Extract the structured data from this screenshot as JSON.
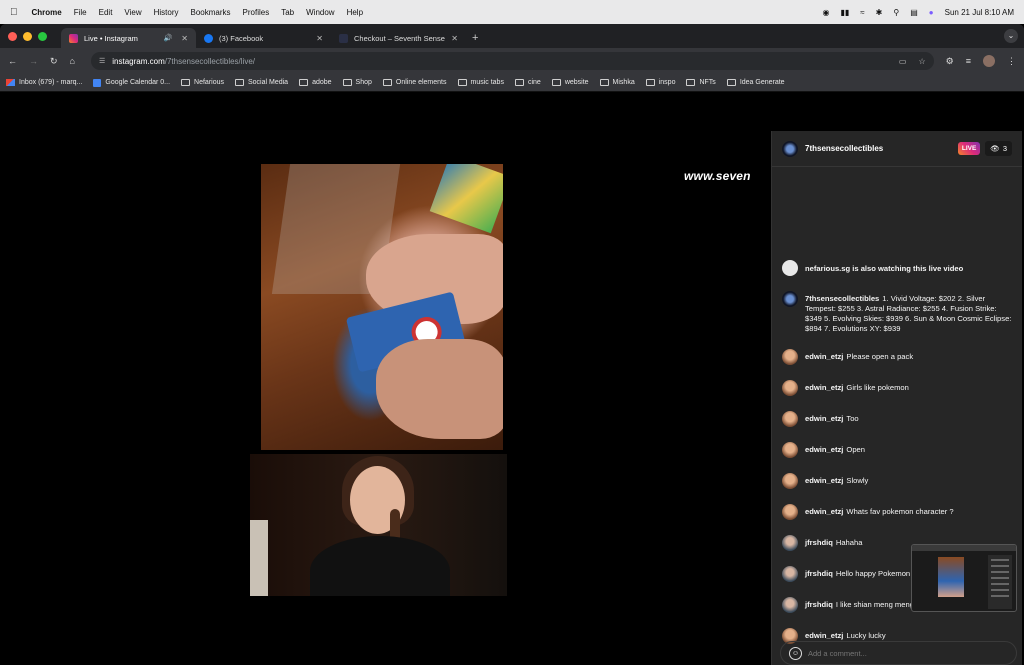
{
  "menubar": {
    "app": "Chrome",
    "items": [
      "File",
      "Edit",
      "View",
      "History",
      "Bookmarks",
      "Profiles",
      "Tab",
      "Window",
      "Help"
    ],
    "clock": "Sun 21 Jul  8:10 AM"
  },
  "tabs": [
    {
      "title": "Live • Instagram",
      "active": true,
      "color": "#dd2a7b"
    },
    {
      "title": "(3) Facebook",
      "active": false,
      "color": "#1877f2"
    },
    {
      "title": "Checkout – Seventh Sense C",
      "active": false,
      "color": "#555"
    }
  ],
  "address": {
    "host": "instagram.com",
    "path": "/7thsensecollectibles/live/"
  },
  "bookmarks": [
    {
      "label": "Inbox (679) - marq...",
      "kind": "gmail"
    },
    {
      "label": "Google Calendar 0...",
      "kind": "gcal"
    },
    {
      "label": "Nefarious",
      "kind": "folder"
    },
    {
      "label": "Social Media",
      "kind": "folder"
    },
    {
      "label": "adobe",
      "kind": "folder"
    },
    {
      "label": "Shop",
      "kind": "folder"
    },
    {
      "label": "Online elements",
      "kind": "folder"
    },
    {
      "label": "music tabs",
      "kind": "folder"
    },
    {
      "label": "cine",
      "kind": "folder"
    },
    {
      "label": "website",
      "kind": "folder"
    },
    {
      "label": "Mishka",
      "kind": "folder"
    },
    {
      "label": "inspo",
      "kind": "folder"
    },
    {
      "label": "NFTs",
      "kind": "folder"
    },
    {
      "label": "Idea Generate",
      "kind": "folder"
    }
  ],
  "stream": {
    "watermark": "www.seven"
  },
  "chat": {
    "host": "7thsensecollectibles",
    "live_label": "LIVE",
    "viewer_count": "3",
    "comment_placeholder": "Add a comment...",
    "messages": [
      {
        "user": "",
        "text": "nefarious.sg is also watching this live video",
        "avatar": "tv",
        "system": true
      },
      {
        "user": "7thsensecollectibles",
        "text": "1. Vivid Voltage: $202 2. Silver Tempest: $255 3. Astral Radiance: $255 4. Fusion Strike: $349 5. Evolving Skies: $939 6. Sun & Moon Cosmic Eclipse: $894 7. Evolutions XY: $939",
        "avatar": "brand",
        "system": false
      },
      {
        "user": "edwin_etzj",
        "text": "Please open a pack",
        "avatar": "edwin",
        "system": false
      },
      {
        "user": "edwin_etzj",
        "text": "Girls like pokemon",
        "avatar": "edwin",
        "system": false
      },
      {
        "user": "edwin_etzj",
        "text": "Too",
        "avatar": "edwin",
        "system": false
      },
      {
        "user": "edwin_etzj",
        "text": "Open",
        "avatar": "edwin",
        "system": false
      },
      {
        "user": "edwin_etzj",
        "text": "Slowly",
        "avatar": "edwin",
        "system": false
      },
      {
        "user": "edwin_etzj",
        "text": "Whats fav pokemon character ?",
        "avatar": "edwin",
        "system": false
      },
      {
        "user": "jfrshdiq",
        "text": "Hahaha",
        "avatar": "jfr",
        "system": false
      },
      {
        "user": "jfrshdiq",
        "text": "Hello happy Pokemon ing",
        "avatar": "jfr",
        "system": false
      },
      {
        "user": "jfrshdiq",
        "text": "I like shian meng meng Pokemon tak Sgt heheh",
        "avatar": "jfr",
        "system": false
      },
      {
        "user": "edwin_etzj",
        "text": "Lucky lucky",
        "avatar": "edwin",
        "system": false
      }
    ]
  }
}
